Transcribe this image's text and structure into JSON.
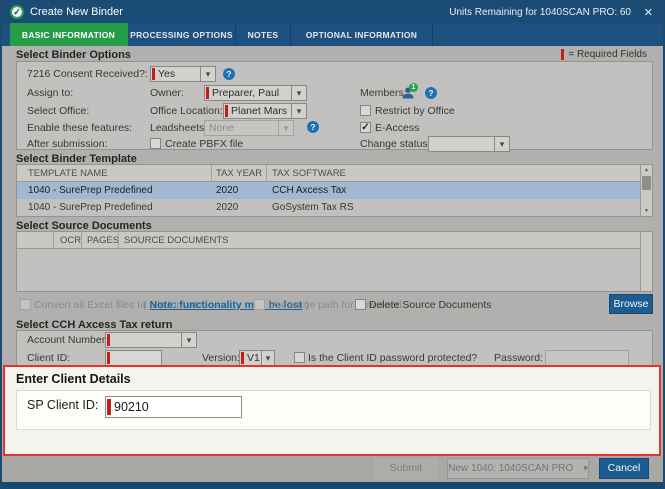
{
  "window": {
    "title": "Create New Binder",
    "units_remaining": "Units Remaining for 1040SCAN PRO: 60"
  },
  "icons": {
    "close": "✕",
    "chevron": "▾",
    "help": "?",
    "check": "✓",
    "scroll_up": "▲",
    "scroll_down": "▼"
  },
  "tabs": [
    {
      "label": "BASIC INFORMATION",
      "active": true
    },
    {
      "label": "PROCESSING OPTIONS",
      "active": false
    },
    {
      "label": "NOTES",
      "active": false
    },
    {
      "label": "OPTIONAL INFORMATION",
      "active": false
    }
  ],
  "binder_options": {
    "section_title": "Select Binder Options",
    "required_legend": "= Required Fields",
    "consent": {
      "label": "7216 Consent Received?:",
      "value": "Yes"
    },
    "assign_to_label": "Assign to:",
    "owner": {
      "label": "Owner:",
      "value": "Preparer, Paul"
    },
    "members_label": "Members:",
    "members_count": "1",
    "select_office_label": "Select Office:",
    "office_location": {
      "label": "Office Location:",
      "value": "Planet Mars"
    },
    "restrict_by_office_label": "Restrict by Office",
    "enable_features_label": "Enable these features:",
    "leadsheets": {
      "label": "Leadsheets:",
      "value": "None"
    },
    "eaccess_label": "E-Access",
    "after_submission_label": "After submission:",
    "create_pbfx_label": "Create PBFX file",
    "change_status_label": "Change status to:"
  },
  "binder_template": {
    "section_title": "Select Binder Template",
    "columns": {
      "name": "TEMPLATE NAME",
      "year": "TAX YEAR",
      "software": "TAX SOFTWARE"
    },
    "rows": [
      {
        "name": "1040 - SurePrep Predefined",
        "year": "2020",
        "software": "CCH Axcess Tax"
      },
      {
        "name": "1040 - SurePrep Predefined",
        "year": "2020",
        "software": "GoSystem Tax RS"
      }
    ]
  },
  "source_documents": {
    "section_title": "Select Source Documents",
    "columns": {
      "ocr": "OCR",
      "pages": "PAGES",
      "docs": "SOURCE DOCUMENTS"
    },
    "convert_excel_label": "Convert all Excel files to .xls format",
    "note_prefix": "(",
    "note_link": "Note: functionality may be lost",
    "note_suffix": ")",
    "use_same_path_label": "Use same path for download",
    "delete_docs_label": "Delete Source Documents",
    "browse_label": "Browse"
  },
  "tax_return": {
    "section_title": "Select CCH Axcess Tax return",
    "account_number_label": "Account Number:",
    "client_id_label": "Client ID:",
    "version": {
      "label": "Version:",
      "value": "V1"
    },
    "password_protected_label": "Is the Client ID password protected?",
    "password_label": "Password:"
  },
  "client_details": {
    "section_title": "Enter Client Details",
    "sp_client_id_label": "SP Client ID:",
    "sp_client_id_value": "90210"
  },
  "footer": {
    "submit_label": "Submit",
    "scan_type_value": "New 1040: 1040SCAN PRO",
    "cancel_label": "Cancel"
  },
  "colors": {
    "title_bar": "#1b4c75",
    "tab_bar": "#1e5180",
    "active_tab_green": "#279c47",
    "accent_button_blue": "#1d5c8f",
    "required_red": "#c41e1a",
    "highlight_border_red": "#e0352b",
    "selected_row_blue": "#9fb9d2",
    "link_blue": "#15659e"
  }
}
